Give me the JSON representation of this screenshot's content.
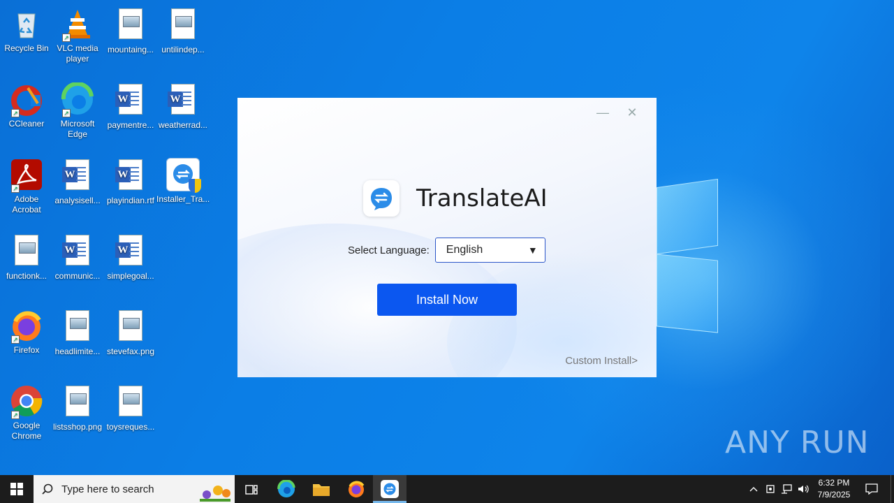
{
  "desktop": {
    "icons": [
      {
        "label": "Recycle Bin"
      },
      {
        "label": "VLC media player"
      },
      {
        "label": "mountaing..."
      },
      {
        "label": "untilindep..."
      },
      {
        "label": "CCleaner"
      },
      {
        "label": "Microsoft Edge"
      },
      {
        "label": "paymentre..."
      },
      {
        "label": "weatherrad..."
      },
      {
        "label": "Adobe Acrobat"
      },
      {
        "label": "analysisell..."
      },
      {
        "label": "playindian.rtf"
      },
      {
        "label": "Installer_Tra..."
      },
      {
        "label": "functionk..."
      },
      {
        "label": "communic..."
      },
      {
        "label": "simplegoal..."
      },
      {
        "label": "Firefox"
      },
      {
        "label": "headlimite..."
      },
      {
        "label": "stevefax.png"
      },
      {
        "label": "Google Chrome"
      },
      {
        "label": "listsshop.png"
      },
      {
        "label": "toysreques..."
      }
    ]
  },
  "installer": {
    "app_name": "TranslateAI",
    "language_label": "Select Language:",
    "language_value": "English",
    "dropdown_arrow": "▼",
    "install_button": "Install Now",
    "custom_install": "Custom Install>",
    "minimize_glyph": "—",
    "close_glyph": "✕",
    "accent_color": "#0b57f0"
  },
  "taskbar": {
    "search_placeholder": "Type here to search",
    "time": "6:32 PM",
    "date": "7/9/2025"
  },
  "watermark": "ANY RUN"
}
